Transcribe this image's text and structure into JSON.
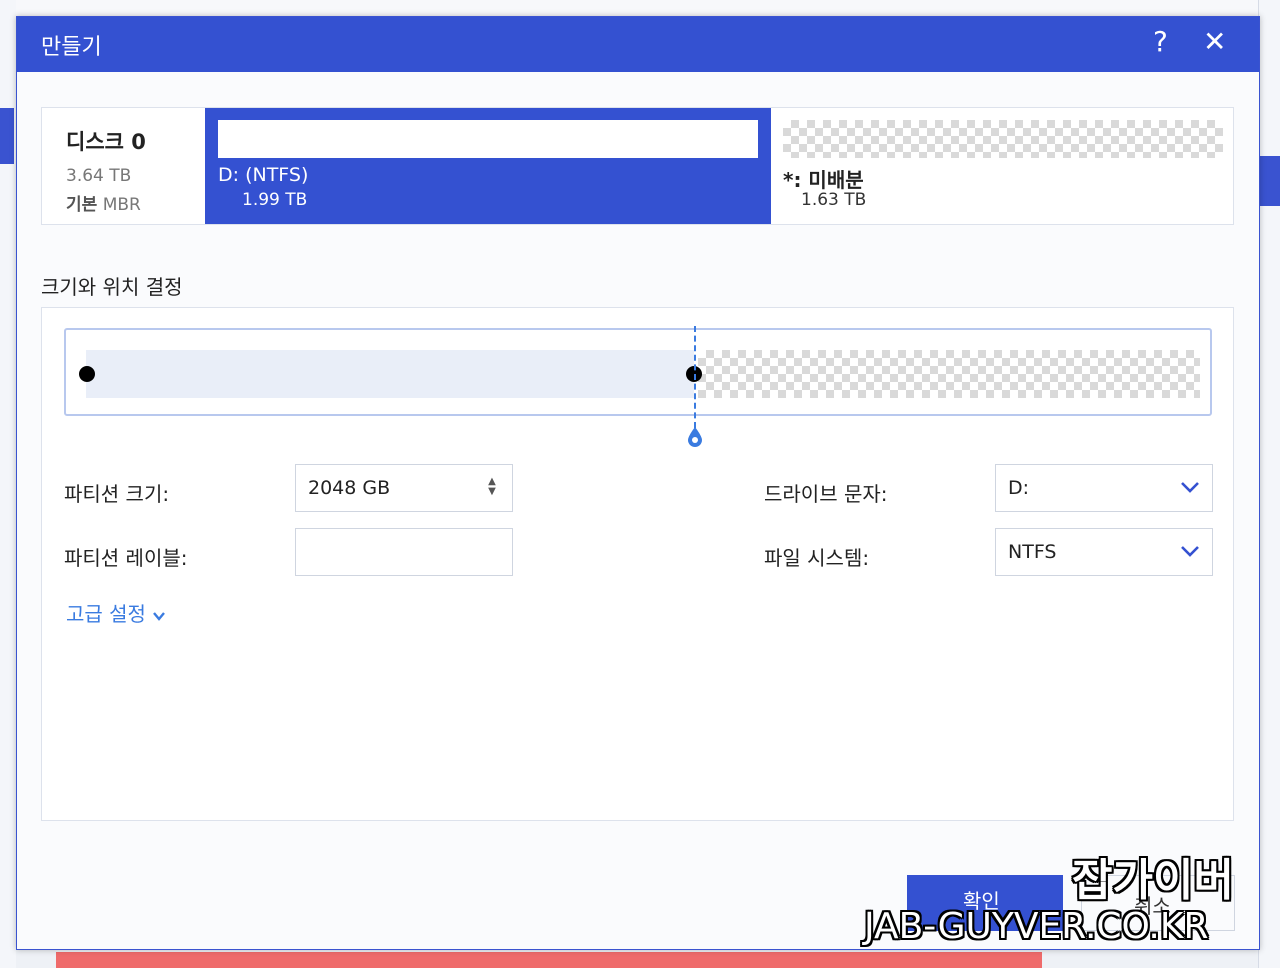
{
  "dialog": {
    "title": "만들기",
    "help_label": "?",
    "close_label": "✕"
  },
  "disk": {
    "name": "디스크 0",
    "size": "3.64 TB",
    "type_label": "기본",
    "type_value": "MBR",
    "partitions": [
      {
        "name": "D: (NTFS)",
        "size": "1.99 TB"
      },
      {
        "name": "*: 미배분",
        "size": "1.63 TB"
      }
    ]
  },
  "section": {
    "title": "크기와 위치 결정"
  },
  "slider": {
    "used_fraction": 0.54
  },
  "form": {
    "partition_size_label": "파티션 크기:",
    "partition_size_value": "2048 GB",
    "partition_label_label": "파티션 레이블:",
    "partition_label_value": "",
    "drive_letter_label": "드라이브 문자:",
    "drive_letter_value": "D:",
    "filesystem_label": "파일 시스템:",
    "filesystem_value": "NTFS"
  },
  "advanced": {
    "label": "고급 설정"
  },
  "buttons": {
    "ok": "확인",
    "cancel": "취소"
  },
  "watermark": {
    "line1": "잡가이버",
    "line2": "JAB-GUYVER.CO.KR"
  },
  "colors": {
    "accent": "#3451d1",
    "link": "#3a7be0"
  }
}
